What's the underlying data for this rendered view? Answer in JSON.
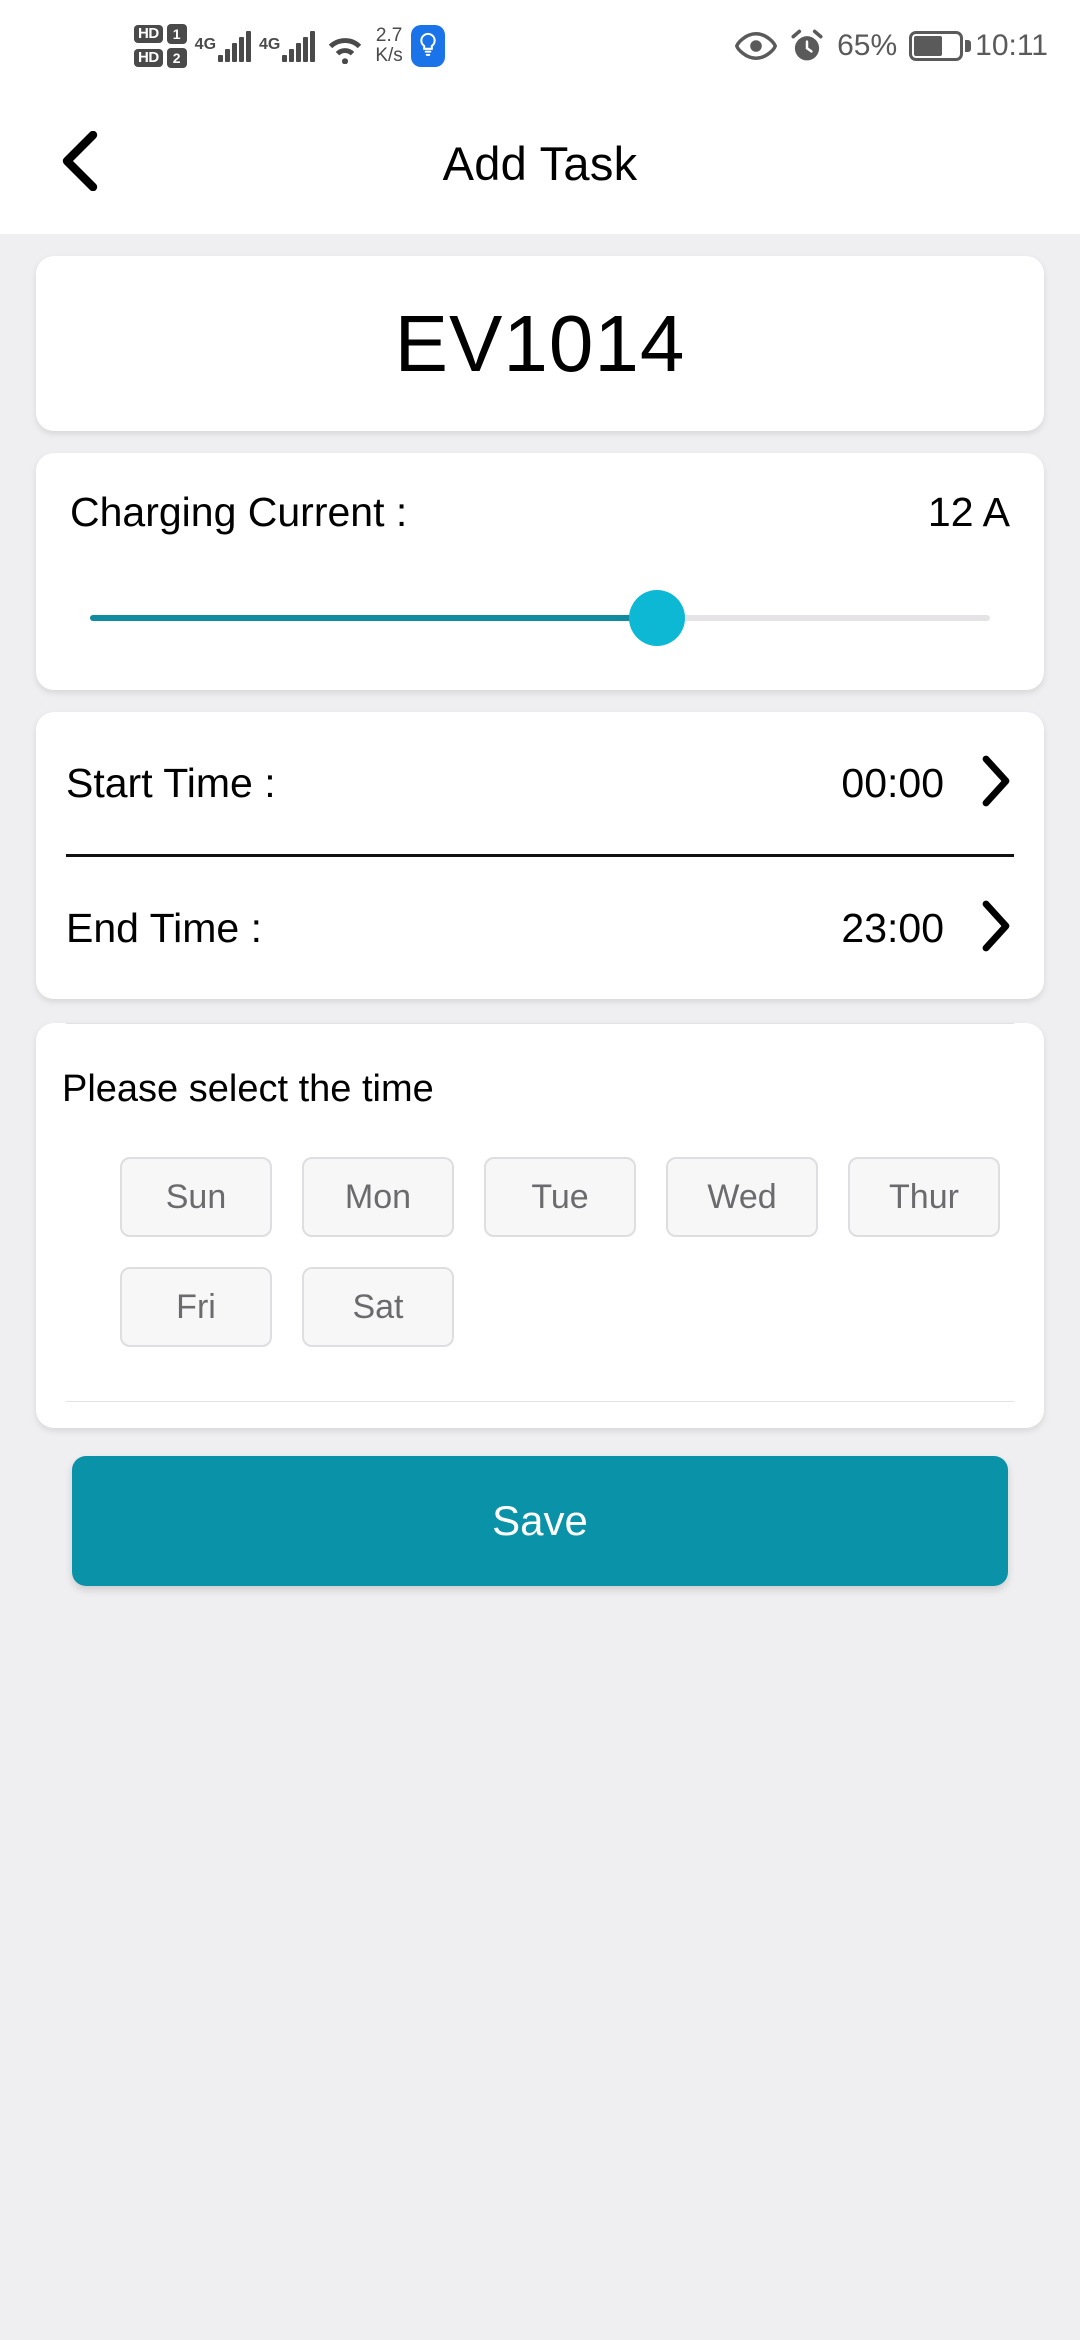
{
  "statusbar": {
    "hd_label_1": "HD",
    "hd_num_1": "1",
    "hd_label_2": "HD",
    "hd_num_2": "2",
    "sim1_network": "4G",
    "sim2_network": "4G",
    "net_speed_value": "2.7",
    "net_speed_unit": "K/s",
    "battery_percent": "65%",
    "clock": "10:11",
    "icons": {
      "wifi": "wifi-icon",
      "bulb": "lightbulb-icon",
      "eye": "eye-comfort-icon",
      "alarm": "alarm-clock-icon",
      "battery": "battery-icon"
    }
  },
  "header": {
    "title": "Add Task",
    "back_icon": "chevron-left-icon"
  },
  "device": {
    "name": "EV1014"
  },
  "charging_current": {
    "label": "Charging Current :",
    "value": "12 A",
    "slider_percent": 63
  },
  "schedule": {
    "start": {
      "label": "Start Time :",
      "value": "00:00",
      "chevron": "chevron-right-icon"
    },
    "end": {
      "label": "End Time :",
      "value": "23:00",
      "chevron": "chevron-right-icon"
    }
  },
  "days": {
    "hint": "Please select the time",
    "items": [
      {
        "label": "Sun",
        "selected": false
      },
      {
        "label": "Mon",
        "selected": false
      },
      {
        "label": "Tue",
        "selected": false
      },
      {
        "label": "Wed",
        "selected": false
      },
      {
        "label": "Thur",
        "selected": false
      },
      {
        "label": "Fri",
        "selected": false
      },
      {
        "label": "Sat",
        "selected": false
      }
    ]
  },
  "actions": {
    "save_label": "Save"
  },
  "colors": {
    "accent": "#0a93a8",
    "slider_thumb": "#0cb8d4",
    "slider_fill": "#0f8ca0",
    "page_background": "#efeff1",
    "card_background": "#ffffff",
    "bulb_badge": "#1a73e8"
  }
}
